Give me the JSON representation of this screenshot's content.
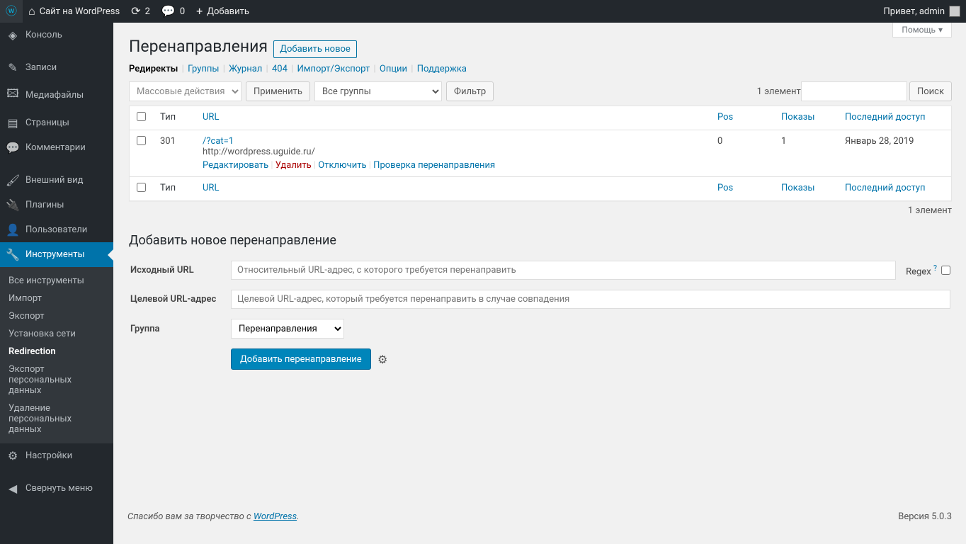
{
  "adminbar": {
    "site_name": "Сайт на WordPress",
    "updates_count": "2",
    "comments_count": "0",
    "add_new": "Добавить",
    "greeting": "Привет, admin"
  },
  "sidebar": {
    "items": [
      {
        "icon": "◈",
        "label": "Консоль"
      },
      {
        "icon": "✎",
        "label": "Записи"
      },
      {
        "icon": "🖾",
        "label": "Медиафайлы"
      },
      {
        "icon": "▤",
        "label": "Страницы"
      },
      {
        "icon": "💬",
        "label": "Комментарии"
      },
      {
        "icon": "🖌",
        "label": "Внешний вид"
      },
      {
        "icon": "🔌",
        "label": "Плагины"
      },
      {
        "icon": "👤",
        "label": "Пользователи"
      },
      {
        "icon": "🔧",
        "label": "Инструменты"
      },
      {
        "icon": "⚙",
        "label": "Настройки"
      },
      {
        "icon": "◀",
        "label": "Свернуть меню"
      }
    ],
    "submenu": [
      "Все инструменты",
      "Импорт",
      "Экспорт",
      "Установка сети",
      "Redirection",
      "Экспорт персональных данных",
      "Удаление персональных данных"
    ]
  },
  "screen": {
    "help": "Помощь"
  },
  "page": {
    "title": "Перенаправления",
    "add_new": "Добавить новое"
  },
  "subnav": {
    "redirects": "Редиректы",
    "groups": "Группы",
    "log": "Журнал",
    "fof": "404",
    "io": "Импорт/Экспорт",
    "options": "Опции",
    "support": "Поддержка"
  },
  "search": {
    "button": "Поиск"
  },
  "bulk": {
    "placeholder": "Массовые действия",
    "apply": "Применить",
    "groups": "Все группы",
    "filter": "Фильтр"
  },
  "table": {
    "count": "1 элемент",
    "cols": {
      "type": "Тип",
      "url": "URL",
      "pos": "Pos",
      "hits": "Показы",
      "last": "Последний доступ"
    },
    "rows": [
      {
        "type": "301",
        "url": "/?cat=1",
        "target": "http://wordpress.uguide.ru/",
        "pos": "0",
        "hits": "1",
        "last": "Январь 28, 2019"
      }
    ],
    "actions": {
      "edit": "Редактировать",
      "delete": "Удалить",
      "disable": "Отключить",
      "check": "Проверка перенаправления"
    }
  },
  "add_form": {
    "heading": "Добавить новое перенаправление",
    "source_label": "Исходный URL",
    "source_placeholder": "Относительный URL-адрес, с которого требуется перенаправить",
    "regex_label": "Regex",
    "target_label": "Целевой URL-адрес",
    "target_placeholder": "Целевой URL-адрес, который требуется перенаправить в случае совпадения",
    "group_label": "Группа",
    "group_option": "Перенаправления",
    "submit": "Добавить перенаправление"
  },
  "footer": {
    "thanks_pre": "Спасибо вам за творчество с ",
    "wordpress": "WordPress",
    "version": "Версия 5.0.3"
  }
}
